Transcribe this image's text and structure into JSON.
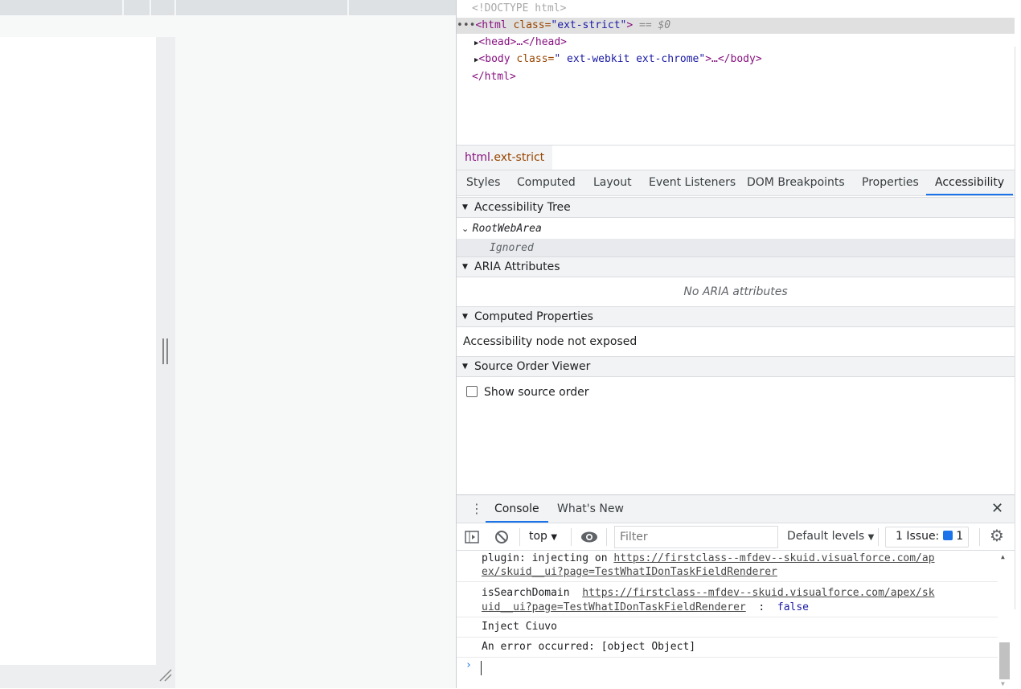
{
  "elements": {
    "doctype": "<!DOCTYPE html>",
    "html_open_prefix": "<html ",
    "html_attr": "class=",
    "html_val": "\"ext-strict\"",
    "html_close": ">",
    "html_selected_suffix": "== $0",
    "head": "<head>…</head>",
    "body_prefix": "<body ",
    "body_attr": "class=",
    "body_val": "\"  ext-webkit ext-chrome\"",
    "body_suffix": ">…</body>",
    "html_end": "</html>"
  },
  "breadcrumb": {
    "tag": "html",
    "cls": ".ext-strict"
  },
  "tabs": [
    "Styles",
    "Computed",
    "Layout",
    "Event Listeners",
    "DOM Breakpoints",
    "Properties",
    "Accessibility"
  ],
  "active_tab": "Accessibility",
  "accessibility": {
    "tree_title": "Accessibility Tree",
    "root": "RootWebArea",
    "ignored": "Ignored",
    "aria_title": "ARIA Attributes",
    "aria_empty": "No ARIA attributes",
    "computed_title": "Computed Properties",
    "computed_text": "Accessibility node not exposed",
    "source_title": "Source Order Viewer",
    "show_source_order": "Show source order",
    "show_source_order_checked": false
  },
  "drawer": {
    "tabs": [
      "Console",
      "What's New"
    ],
    "context": "top",
    "filter_placeholder": "Filter",
    "levels": "Default levels",
    "issues_label": "1 Issue:",
    "issues_count": "1"
  },
  "console": [
    {
      "prefix": "plugin: injecting on ",
      "link1": "https://firstclass--mfdev--skuid.visualforce.com/ap",
      "link2": "ex/skuid__ui?page=TestWhatIDonTaskFieldRenderer"
    },
    {
      "prefix": "isSearchDomain  ",
      "link1": "https://firstclass--mfdev--skuid.visualforce.com/apex/sk",
      "link2": "uid__ui?page=TestWhatIDonTaskFieldRenderer",
      "sep": "  :  ",
      "value": "false"
    },
    {
      "text": "Inject Ciuvo"
    },
    {
      "text": "An error occurred: [object Object]"
    }
  ],
  "colors": {
    "accent": "#1a73e8",
    "selected_row": "#e0e0e0"
  }
}
